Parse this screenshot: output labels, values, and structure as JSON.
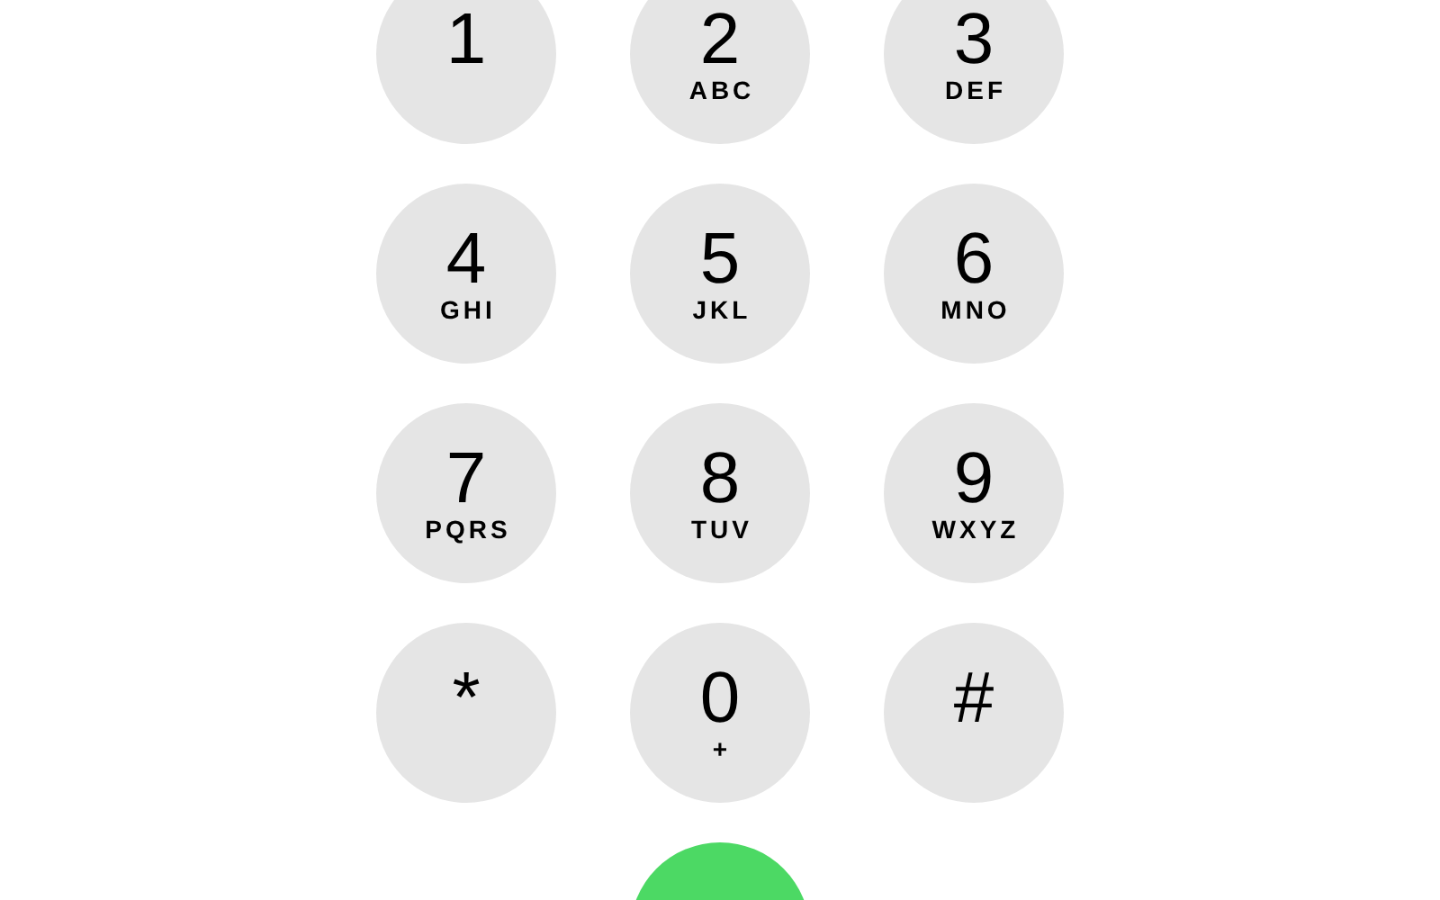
{
  "keypad": {
    "keys": [
      {
        "digit": "1"
      },
      {
        "digit": "2",
        "letters": "ABC"
      },
      {
        "digit": "3",
        "letters": "DEF"
      },
      {
        "digit": "4",
        "letters": "GHI"
      },
      {
        "digit": "5",
        "letters": "JKL"
      },
      {
        "digit": "6",
        "letters": "MNO"
      },
      {
        "digit": "7",
        "letters": "PQRS"
      },
      {
        "digit": "8",
        "letters": "TUV"
      },
      {
        "digit": "9",
        "letters": "WXYZ"
      },
      {
        "digit": "*"
      },
      {
        "digit": "0",
        "letters": "+"
      },
      {
        "digit": "#"
      }
    ]
  }
}
